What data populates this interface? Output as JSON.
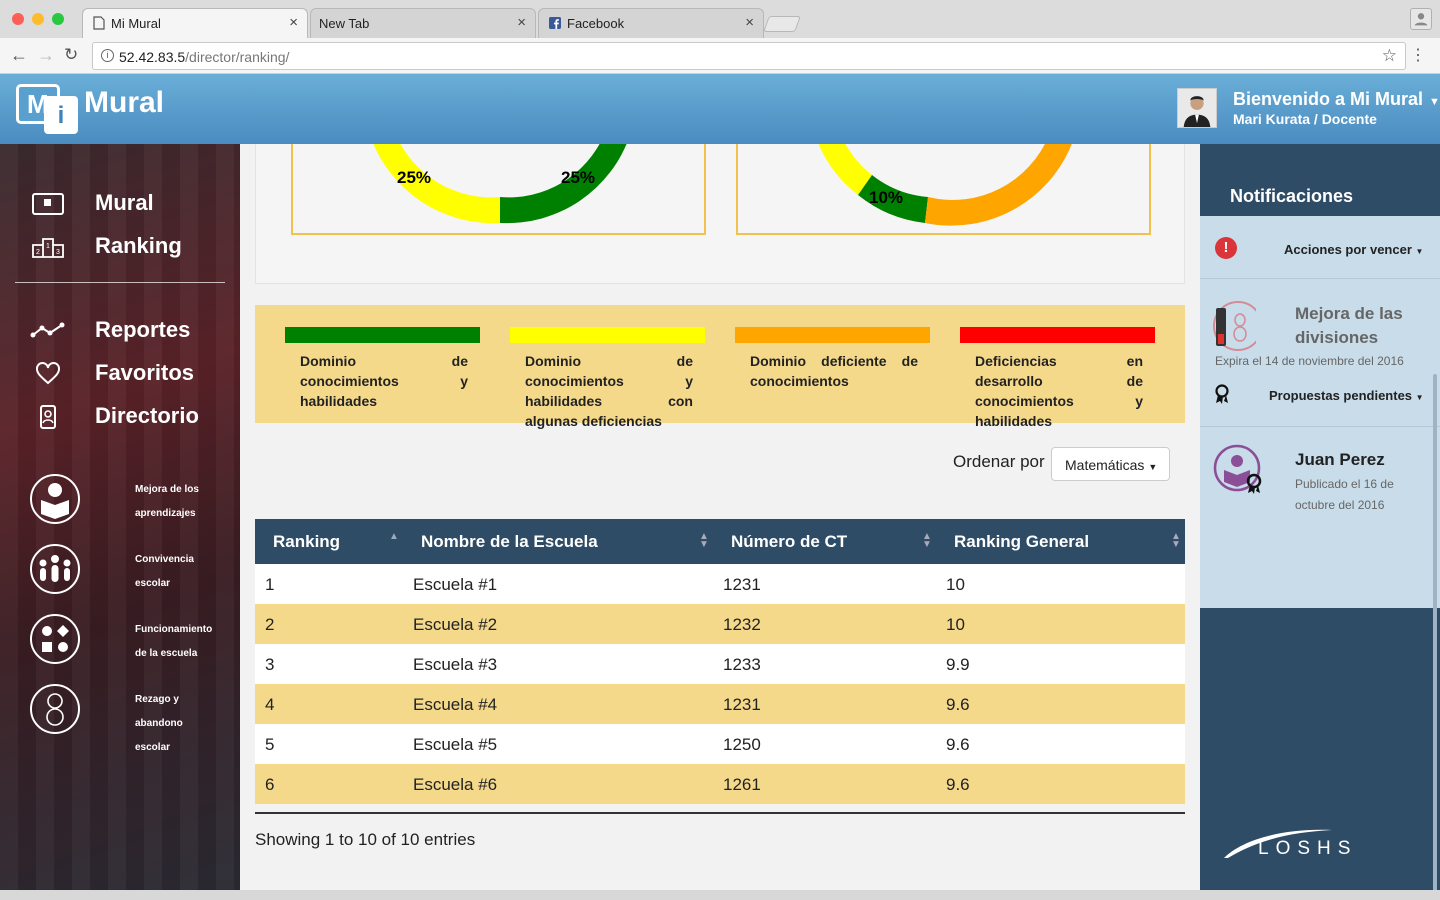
{
  "browser": {
    "tabs": [
      {
        "title": "Mi Mural",
        "icon": "document-icon",
        "active": true
      },
      {
        "title": "New Tab",
        "icon": "",
        "active": false
      },
      {
        "title": "Facebook",
        "icon": "facebook-icon",
        "active": false
      }
    ],
    "url_host": "52.42.83.5",
    "url_path": "/director/ranking/"
  },
  "header": {
    "logo_m": "M",
    "logo_i": "i",
    "logo_text": "Mural",
    "welcome": "Bienvenido a Mi Mural",
    "user_role": "Mari Kurata / Docente"
  },
  "sidebar": {
    "nav": [
      {
        "label": "Mural",
        "icon": "mural-icon"
      },
      {
        "label": "Ranking",
        "icon": "podium-icon"
      },
      {
        "label": "Reportes",
        "icon": "line-chart-icon"
      },
      {
        "label": "Favoritos",
        "icon": "heart-icon"
      },
      {
        "label": "Directorio",
        "icon": "contact-card-icon"
      }
    ],
    "categories": [
      {
        "label_lines": [
          "Mejora de los",
          "aprendizajes"
        ],
        "icon": "reading-person-icon"
      },
      {
        "label_lines": [
          "Convivencia",
          "escolar"
        ],
        "icon": "group-people-icon"
      },
      {
        "label_lines": [
          "Funcionamiento",
          "de la escuela"
        ],
        "icon": "shapes-icon"
      },
      {
        "label_lines": [
          "Rezago y",
          "abandono",
          "escolar"
        ],
        "icon": "figure-eight-icon"
      }
    ]
  },
  "gauges": [
    {
      "labels": [
        "25%",
        "25%"
      ],
      "colors": [
        "#ffff00",
        "#008000"
      ]
    },
    {
      "labels": [
        "10%"
      ],
      "colors": [
        "#ffff00",
        "#008000",
        "#ffa500"
      ]
    }
  ],
  "legend": [
    {
      "color": "#008000",
      "lines": [
        "Dominio de",
        "conocimientos y",
        "habilidades"
      ]
    },
    {
      "color": "#ffff00",
      "lines": [
        "Dominio de",
        "conocimientos y",
        "habilidades con",
        "algunas deficiencias"
      ]
    },
    {
      "color": "#ffa500",
      "lines": [
        "Dominio deficiente de",
        "conocimientos"
      ]
    },
    {
      "color": "#ff0000",
      "lines": [
        "Deficiencias en",
        "desarrollo de",
        "conocimientos y",
        "habilidades"
      ]
    }
  ],
  "order": {
    "label": "Ordenar por",
    "selected": "Matemáticas"
  },
  "table": {
    "headers": [
      "Ranking",
      "Nombre de la Escuela",
      "Número de CT",
      "Ranking General"
    ],
    "rows": [
      [
        "1",
        "Escuela #1",
        "1231",
        "10"
      ],
      [
        "2",
        "Escuela #2",
        "1232",
        "10"
      ],
      [
        "3",
        "Escuela #3",
        "1233",
        "9.9"
      ],
      [
        "4",
        "Escuela #4",
        "1231",
        "9.6"
      ],
      [
        "5",
        "Escuela #5",
        "1250",
        "9.6"
      ],
      [
        "6",
        "Escuela #6",
        "1261",
        "9.6"
      ]
    ],
    "footer": "Showing 1 to 10 of 10 entries"
  },
  "notifications": {
    "title": "Notificaciones",
    "acciones": "Acciones por vencer",
    "goal_title": "Mejora de las divisiones",
    "goal_expira": "Expira el 14 de noviembre del 2016",
    "propuestas": "Propuestas pendientes",
    "person_name": "Juan Perez",
    "person_sub": "Publicado el 16 de octubre del 2016",
    "brand": "LOSHS"
  }
}
